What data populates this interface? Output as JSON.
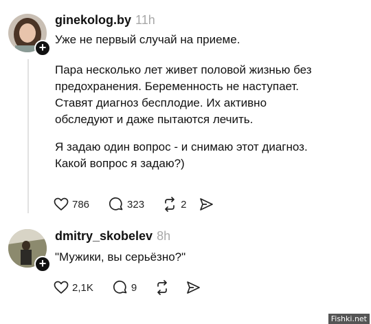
{
  "post": {
    "username": "ginekolog.by",
    "time": "11h",
    "lines": [
      "Уже не первый случай на приеме.",
      "Пара несколько лет живет половой жизнью без",
      "предохранения. Беременность не наступает.",
      "Ставят диагноз бесплодие. Их активно",
      "обследуют и даже пытаются лечить.",
      "Я задаю один вопрос - и снимаю этот диагноз.",
      "Какой вопрос я задаю?)"
    ],
    "likes": "786",
    "comments": "323",
    "reposts": "2",
    "share": ""
  },
  "reply": {
    "username": "dmitry_skobelev",
    "time": "8h",
    "text": "\"Мужики, вы серьёзно?\"",
    "likes": "2,1K",
    "comments": "9",
    "reposts": "",
    "share": ""
  },
  "badge_symbol": "+",
  "watermark": "Fishki.net",
  "icons": {
    "like": "heart-icon",
    "comment": "comment-bubble-icon",
    "repost": "repost-arrows-icon",
    "share": "send-icon"
  }
}
